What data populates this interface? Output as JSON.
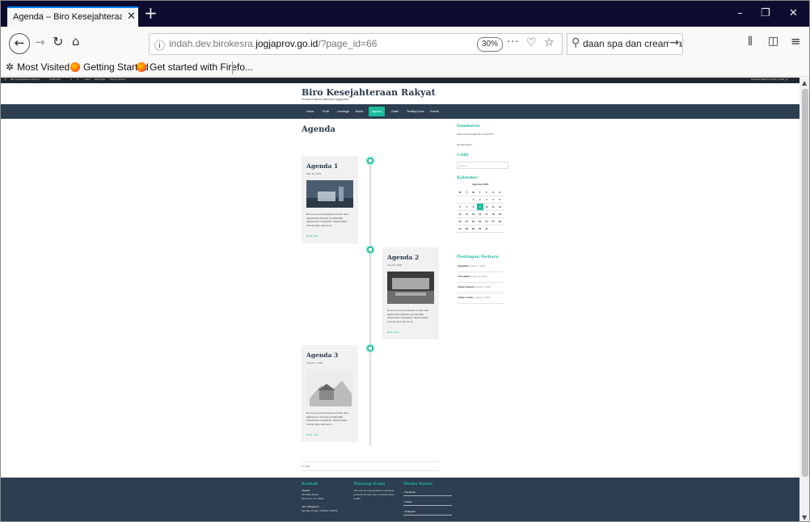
{
  "browser": {
    "tab_title": "Agenda – Biro Kesejahteraan Rakyat",
    "tab_close": "✕",
    "new_tab": "+",
    "url_plain_prefix": "indah.dev.birokesra.",
    "url_domain": "jogjaprov.go.id",
    "url_path": "/?page_id=66",
    "zoom": "30%",
    "page_actions": "···",
    "search_value": "daan spa dan creambatl",
    "window_controls": [
      "–",
      "❐",
      "✕"
    ],
    "bookmarks": [
      "Most Visited",
      "Getting Started",
      "Get started with Firefo..."
    ]
  },
  "adminbar": {
    "left_items": [
      "Biro Kesejahteraan Rakyat",
      "Customize",
      "0",
      "0",
      "+ New",
      "Edit Page",
      "Theme Options"
    ],
    "right_text": "Selamat Datang,   Howdy, indah_ky"
  },
  "site": {
    "title": "Biro Kesejahteraan Rakyat",
    "description": "Provinsi Daerah Istimewa Yogyakarta"
  },
  "nav": {
    "items": [
      "Home",
      "Profil",
      "Lembaga",
      "Berita",
      "Agenda",
      "Galeri",
      "Tentang Kami",
      "Kontak"
    ],
    "active_index": 4
  },
  "page_title": "Agenda",
  "timeline": [
    {
      "title": "Agenda 1",
      "date": "May 30, 2018",
      "excerpt": "Et vero eos et accusamus et iusto odio dignissimos ducimus qui blanditiis praesentium voluptatum deleniti atque corrupti quos dolores et…",
      "more": "Read more"
    },
    {
      "title": "Agenda 2",
      "date": "July 30, 2018",
      "excerpt": "Et vero eos et accusamus et iusto odio dignissimos ducimus qui blanditiis praesentium voluptatum deleniti atque corrupti quos dolores et…",
      "more": "Read more"
    },
    {
      "title": "Agenda 3",
      "date": "August 4, 2018",
      "excerpt": "Et vero eos et accusamus et iusto odio dignissimos ducimus qui blanditiis praesentium voluptatum deleniti atque corrupti quos dolores et…",
      "more": "Read more"
    }
  ],
  "post_nav": "17 walk",
  "sidebar": {
    "sambutan_title": "Sambutan",
    "sambutan_line1": "(Sambutan Kepala Biro Kesra DIY)",
    "sambutan_line2": "(isi Sambutan)",
    "cari_title": "CARI",
    "search_placeholder": "Search ...",
    "kalender_title": "Kalender",
    "calendar": {
      "caption": "Agustus 2018",
      "weekdays": [
        "M",
        "T",
        "W",
        "T",
        "F",
        "S",
        "S"
      ],
      "weeks": [
        [
          "",
          "",
          "1",
          "2",
          "3",
          "4",
          "5"
        ],
        [
          "6",
          "7",
          "8",
          "9",
          "10",
          "11",
          "12"
        ],
        [
          "13",
          "14",
          "15",
          "16",
          "17",
          "18",
          "19"
        ],
        [
          "20",
          "21",
          "22",
          "23",
          "24",
          "25",
          "26"
        ],
        [
          "27",
          "28",
          "29",
          "30",
          "31",
          "",
          ""
        ]
      ],
      "today": "9"
    },
    "recent_title": "Postingan Terbaru",
    "recent": [
      {
        "title": "Kegiatan",
        "date": "August 4, 2018"
      },
      {
        "title": "Teh pahlis",
        "date": "August 4, 2018"
      },
      {
        "title": "Dasar deskrit",
        "date": "August 4, 2018"
      },
      {
        "title": "Galeri umum",
        "date": "August 4, 2018"
      }
    ]
  },
  "footer": {
    "kontak_title": "Kontak",
    "kontak_lines": [
      "Alamat",
      "123 Main Street",
      "New York, NY 10001",
      "",
      "Jam Pelayanan",
      "Monday–Friday: 9:00AM–5:00PM"
    ],
    "tentang_title": "Tentang Kami",
    "tentang_text": "This may be a good place to introduce yourself and your site or include some credits.",
    "media_title": "Media Sosial",
    "media_links": [
      "Facebook",
      "Twitter",
      "Instagram"
    ]
  },
  "colors": {
    "accent": "#1abc9c",
    "navbar": "#2c3e50",
    "browser_tabbar": "#0c0c2e"
  }
}
